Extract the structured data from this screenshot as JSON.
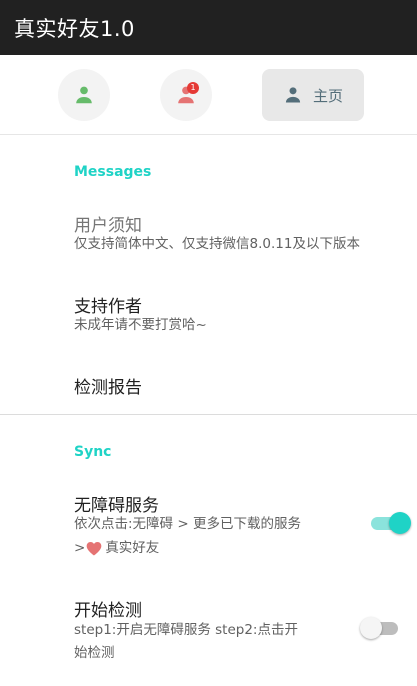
{
  "app": {
    "title": "真实好友1.0"
  },
  "tabs": {
    "contacts_icon": "person-icon",
    "notifications_icon": "person-alert-icon",
    "notifications_badge": "1",
    "home_icon": "person-icon",
    "home_label": "主页"
  },
  "messages": {
    "header": "Messages",
    "notice": {
      "title": "用户须知",
      "summary": "仅支持简体中文、仅支持微信8.0.11及以下版本"
    },
    "support": {
      "title": "支持作者",
      "summary": "未成年请不要打赏哈~"
    },
    "report": {
      "title": "检测报告"
    }
  },
  "sync": {
    "header": "Sync",
    "accessibility": {
      "title": "无障碍服务",
      "summary_line1": "依次点击:无障碍 > 更多已下载的服务",
      "summary_line2_prefix": "> ",
      "summary_line2_icon": "heart-icon",
      "summary_line2_text": "真实好友",
      "enabled": true
    },
    "start_check": {
      "title": "开始检测",
      "summary_line1": "step1:开启无障碍服务 step2:点击开",
      "summary_line2": "始检测",
      "enabled": false
    }
  },
  "colors": {
    "accent": "#1fd3c6",
    "titlebar": "#212121",
    "contacts_icon": "#66bb6a",
    "notifications_icon": "#e57373",
    "badge": "#e53935",
    "home_icon": "#546e7a",
    "heart": "#e57373"
  }
}
